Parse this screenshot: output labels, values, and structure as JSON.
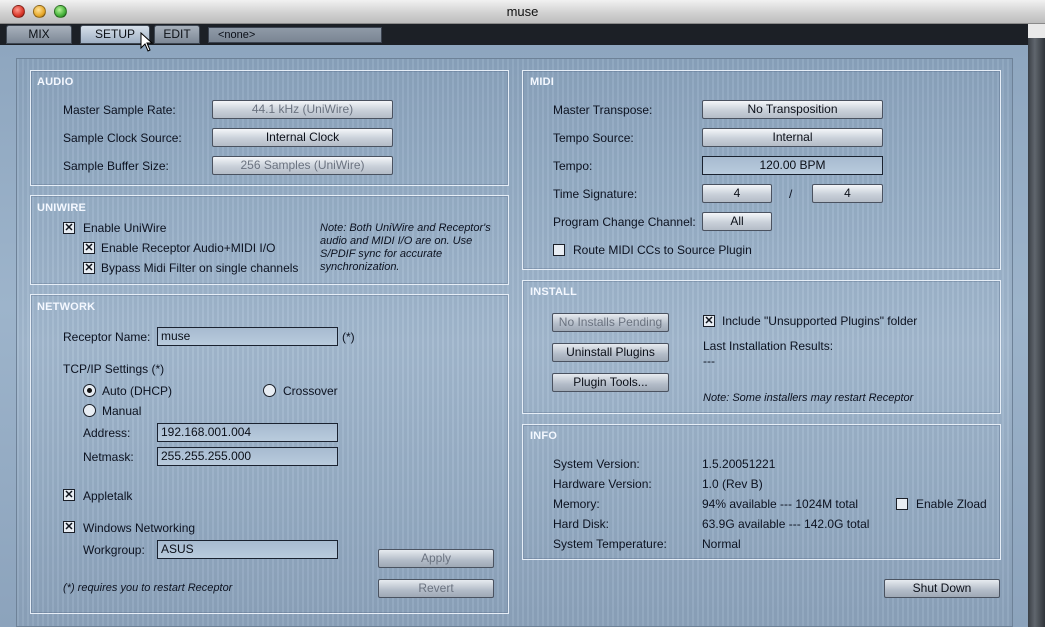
{
  "window": {
    "title": "muse"
  },
  "tabs": [
    {
      "label": "MIX"
    },
    {
      "label": "SETUP"
    },
    {
      "label": "EDIT"
    }
  ],
  "preset": {
    "value": "<none>"
  },
  "audio": {
    "title": "AUDIO",
    "sample_rate_label": "Master Sample Rate:",
    "sample_rate_value": "44.1 kHz (UniWire)",
    "clock_source_label": "Sample Clock Source:",
    "clock_source_value": "Internal Clock",
    "buffer_label": "Sample Buffer Size:",
    "buffer_value": "256 Samples (UniWire)"
  },
  "uniwire": {
    "title": "UNIWIRE",
    "enable_label": "Enable UniWire",
    "enable_receptor_label": "Enable Receptor Audio+MIDI I/O",
    "bypass_label": "Bypass Midi Filter on single channels",
    "note": "Note: Both UniWire and Receptor's audio and MIDI I/O are on. Use S/PDIF sync for accurate synchronization."
  },
  "network": {
    "title": "NETWORK",
    "receptor_name_label": "Receptor Name:",
    "receptor_name_value": "muse",
    "restart_marker": "(*)",
    "tcpip_label": "TCP/IP Settings (*)",
    "auto_label": "Auto (DHCP)",
    "crossover_label": "Crossover",
    "manual_label": "Manual",
    "address_label": "Address:",
    "address_value": "192.168.001.004",
    "netmask_label": "Netmask:",
    "netmask_value": "255.255.255.000",
    "appletalk_label": "Appletalk",
    "windows_label": "Windows Networking",
    "workgroup_label": "Workgroup:",
    "workgroup_value": "ASUS",
    "apply_label": "Apply",
    "revert_label": "Revert",
    "footnote": "(*) requires you to restart Receptor"
  },
  "midi": {
    "title": "MIDI",
    "transpose_label": "Master Transpose:",
    "transpose_value": "No Transposition",
    "tempo_source_label": "Tempo Source:",
    "tempo_source_value": "Internal",
    "tempo_label": "Tempo:",
    "tempo_value": "120.00 BPM",
    "time_sig_label": "Time Signature:",
    "time_sig_num": "4",
    "time_sig_sep": "/",
    "time_sig_den": "4",
    "pc_channel_label": "Program Change Channel:",
    "pc_channel_value": "All",
    "route_cc_label": "Route MIDI CCs to Source Plugin"
  },
  "install": {
    "title": "INSTALL",
    "no_installs_label": "No Installs Pending",
    "uninstall_label": "Uninstall Plugins",
    "plugin_tools_label": "Plugin Tools...",
    "include_unsupported_label": "Include \"Unsupported Plugins\" folder",
    "last_results_label": "Last Installation Results:",
    "last_results_value": "---",
    "note": "Note: Some installers may restart Receptor"
  },
  "info": {
    "title": "INFO",
    "sys_version_label": "System Version:",
    "sys_version_value": "1.5.20051221",
    "hw_version_label": "Hardware Version:",
    "hw_version_value": "1.0 (Rev B)",
    "memory_label": "Memory:",
    "memory_value": "94% available --- 1024M total",
    "zload_label": "Enable Zload",
    "disk_label": "Hard Disk:",
    "disk_value": "63.9G available --- 142.0G total",
    "temp_label": "System Temperature:",
    "temp_value": "Normal"
  },
  "shutdown": {
    "label": "Shut Down"
  },
  "checks": {
    "enable_uniwire": true,
    "enable_receptor": true,
    "bypass_midi": true,
    "appletalk": true,
    "windows_networking": true,
    "route_midi_cc": false,
    "include_unsupported": true,
    "enable_zload": false
  },
  "tcpip_mode": "Auto (DHCP)"
}
